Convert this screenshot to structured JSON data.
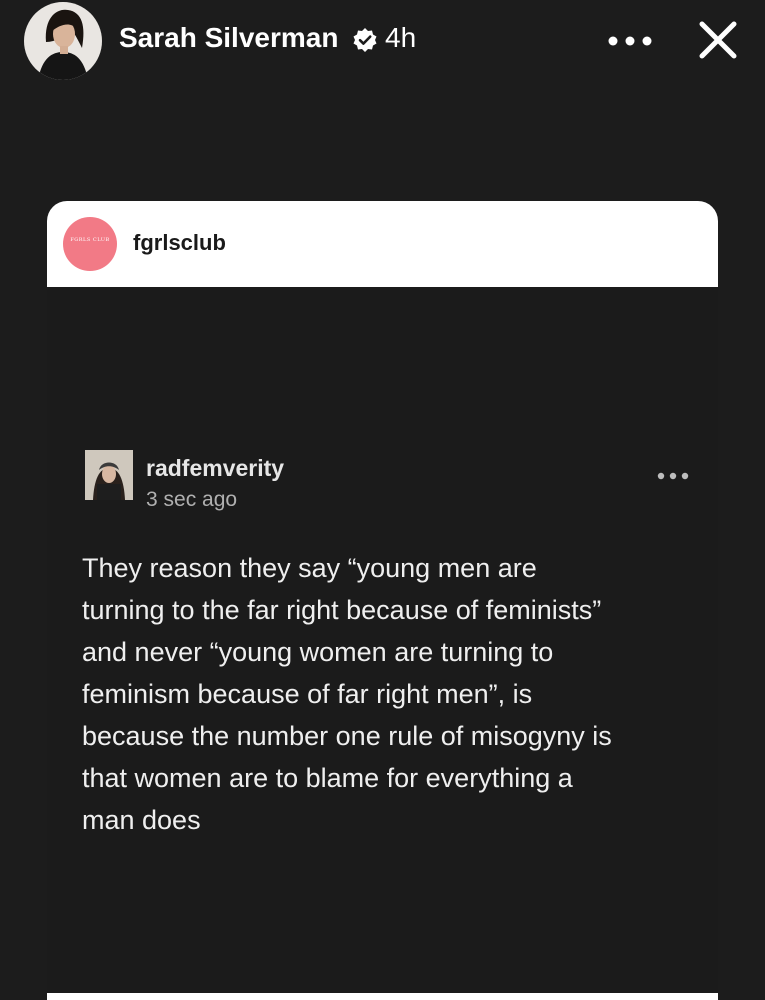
{
  "story": {
    "author_name": "Sarah Silverman",
    "time_ago": "4h",
    "verified": true
  },
  "icons": {
    "verified": "verified-badge-icon",
    "more": "more-horizontal-icon",
    "close": "close-x-icon"
  },
  "shared_post": {
    "source_account": "fgrlsclub",
    "source_logo_text": "FGRLS CLUB",
    "source_logo_color": "#f27a86",
    "post": {
      "username": "radfemverity",
      "timestamp": "3 sec ago",
      "text_lines": [
        "They reason they say “young men are",
        "turning to the far right because of feminists”",
        "and never “young women are turning to",
        "feminism because of far right men”, is",
        "because the number one rule of misogyny is",
        "that women are to blame for everything a",
        "man does"
      ]
    }
  },
  "colors": {
    "background": "#1c1c1c",
    "card_header": "#ffffff",
    "text_primary": "#ffffff",
    "text_secondary": "#b0b0b0"
  }
}
